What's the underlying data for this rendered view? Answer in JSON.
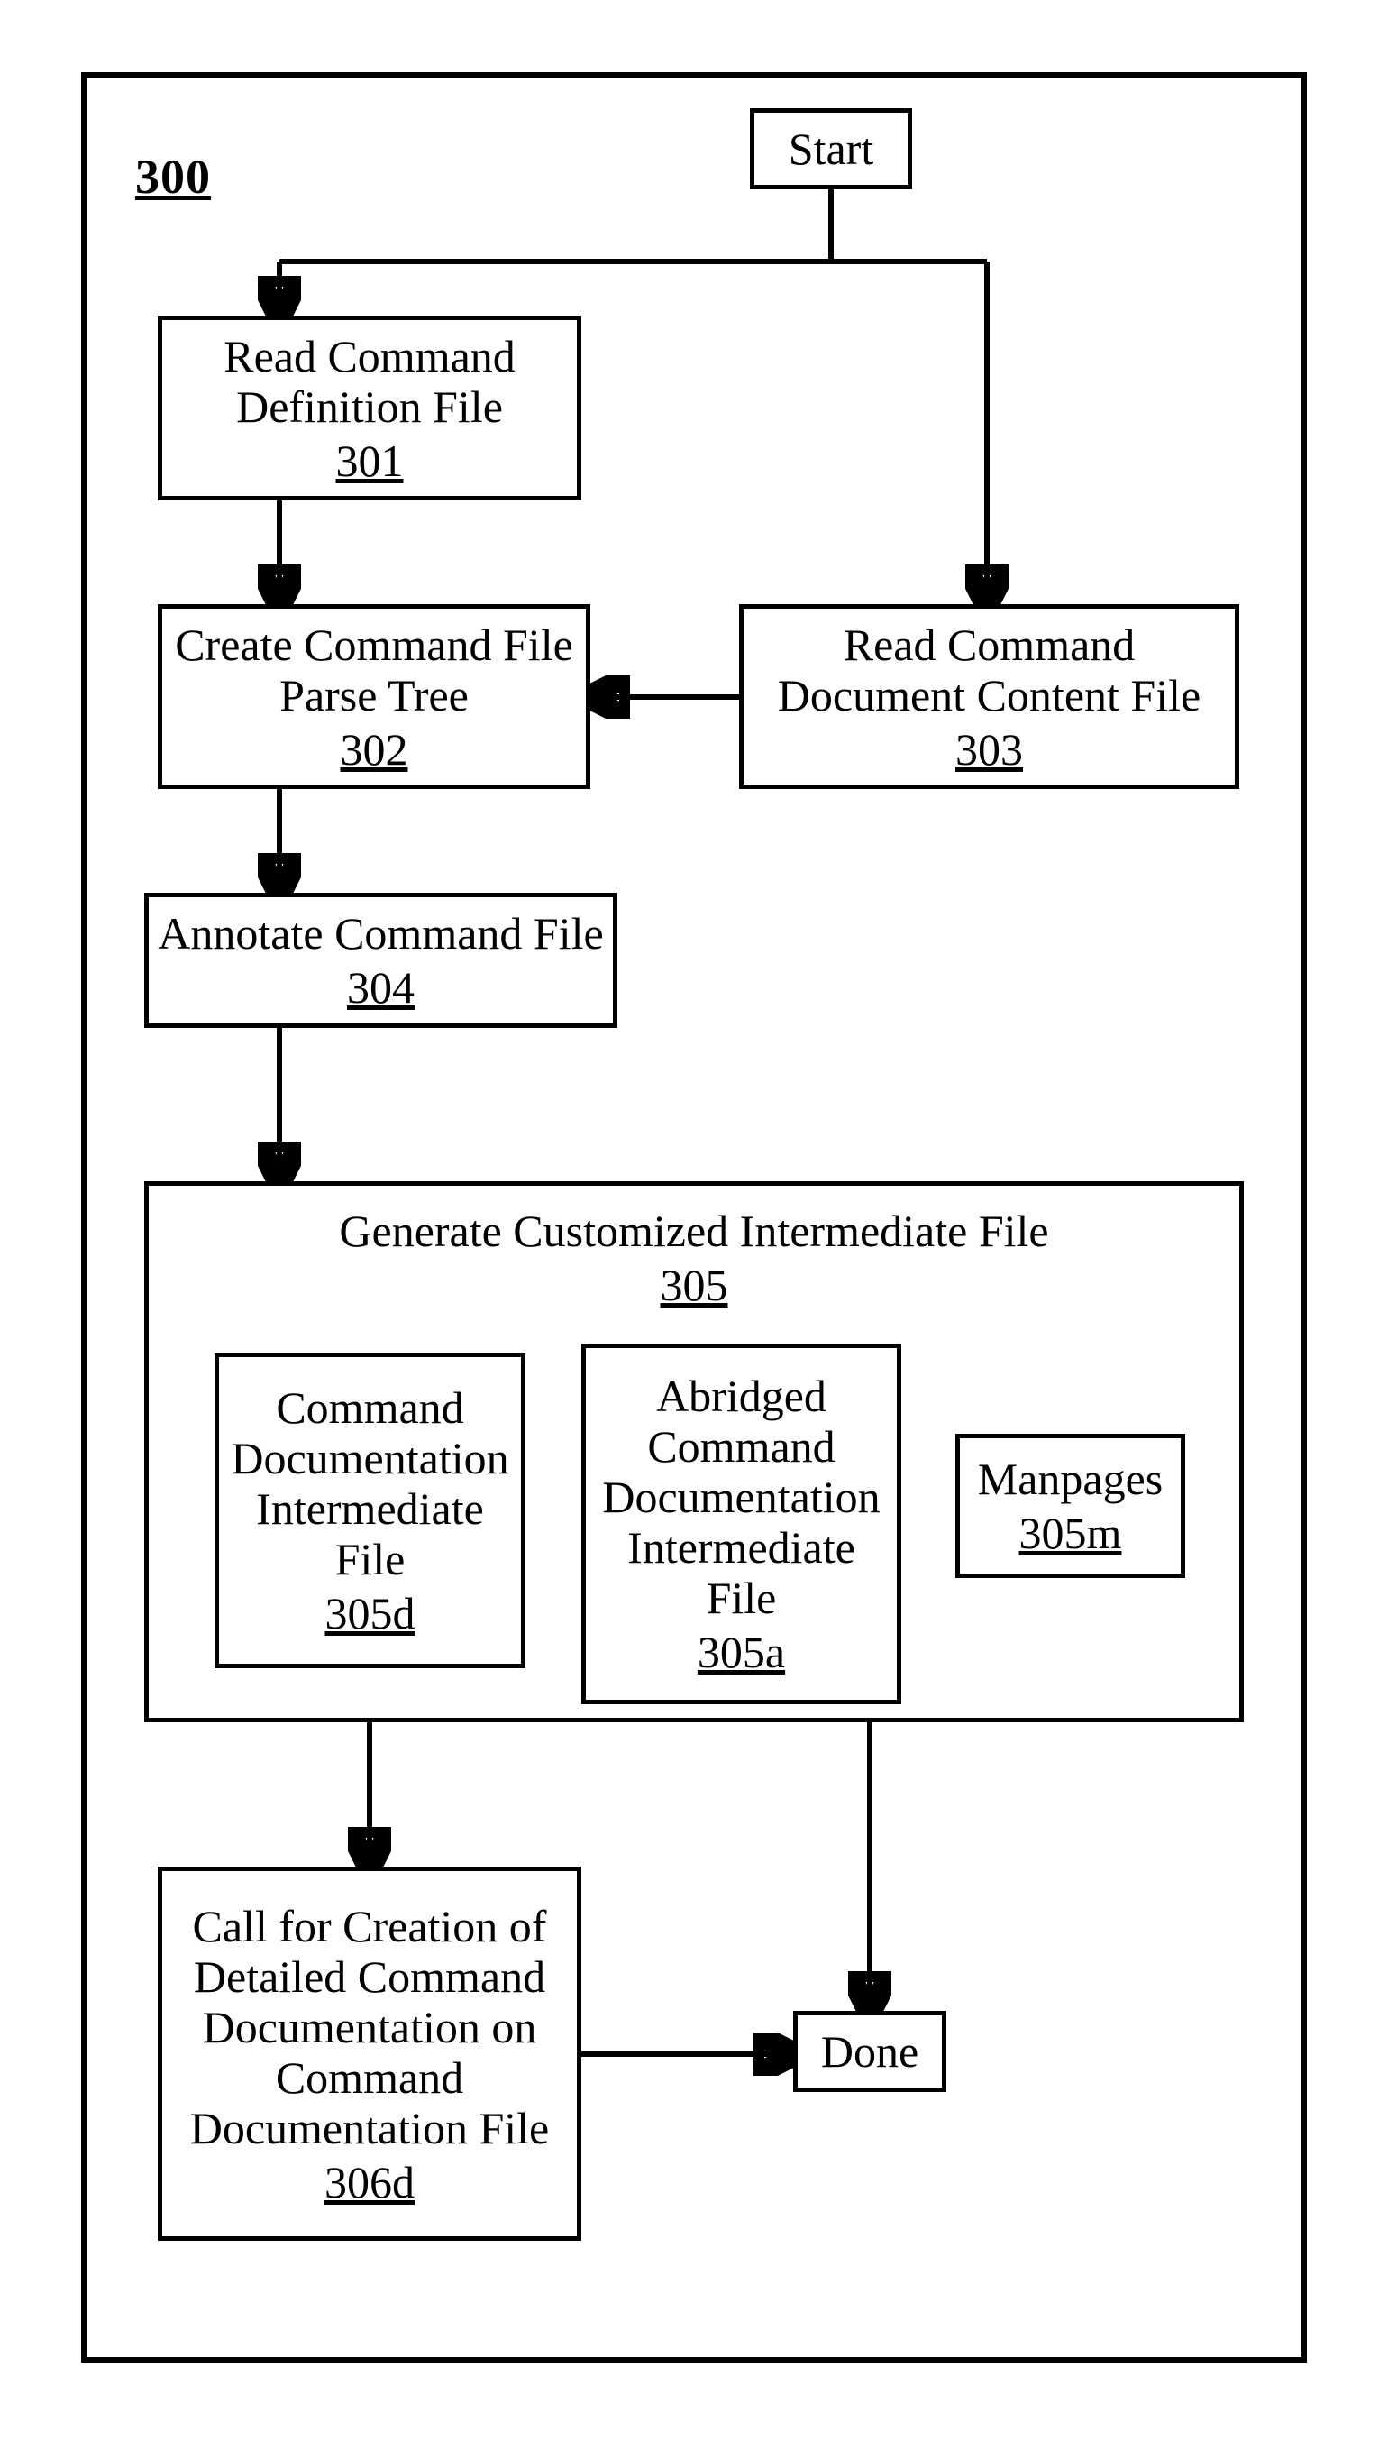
{
  "figure_ref": "300",
  "nodes": {
    "start": {
      "label": "Start"
    },
    "n301": {
      "l1": "Read Command",
      "l2": "Definition File",
      "ref": "301"
    },
    "n302": {
      "l1": "Create Command File",
      "l2": "Parse Tree",
      "ref": "302"
    },
    "n303": {
      "l1": "Read Command",
      "l2": "Document Content File",
      "ref": "303"
    },
    "n304": {
      "l1": "Annotate Command File",
      "ref": "304"
    },
    "n305": {
      "title": "Generate Customized Intermediate File",
      "ref": "305"
    },
    "n305d": {
      "l1": "Command",
      "l2": "Documentation",
      "l3": "Intermediate",
      "l4": "File",
      "ref": "305d"
    },
    "n305a": {
      "l1": "Abridged",
      "l2": "Command",
      "l3": "Documentation",
      "l4": "Intermediate",
      "l5": "File",
      "ref": "305a"
    },
    "n305m": {
      "l1": "Manpages",
      "ref": "305m"
    },
    "n306d": {
      "l1": "Call for Creation of",
      "l2": "Detailed Command",
      "l3": "Documentation on",
      "l4": "Command",
      "l5": "Documentation File",
      "ref": "306d"
    },
    "done": {
      "label": "Done"
    }
  }
}
